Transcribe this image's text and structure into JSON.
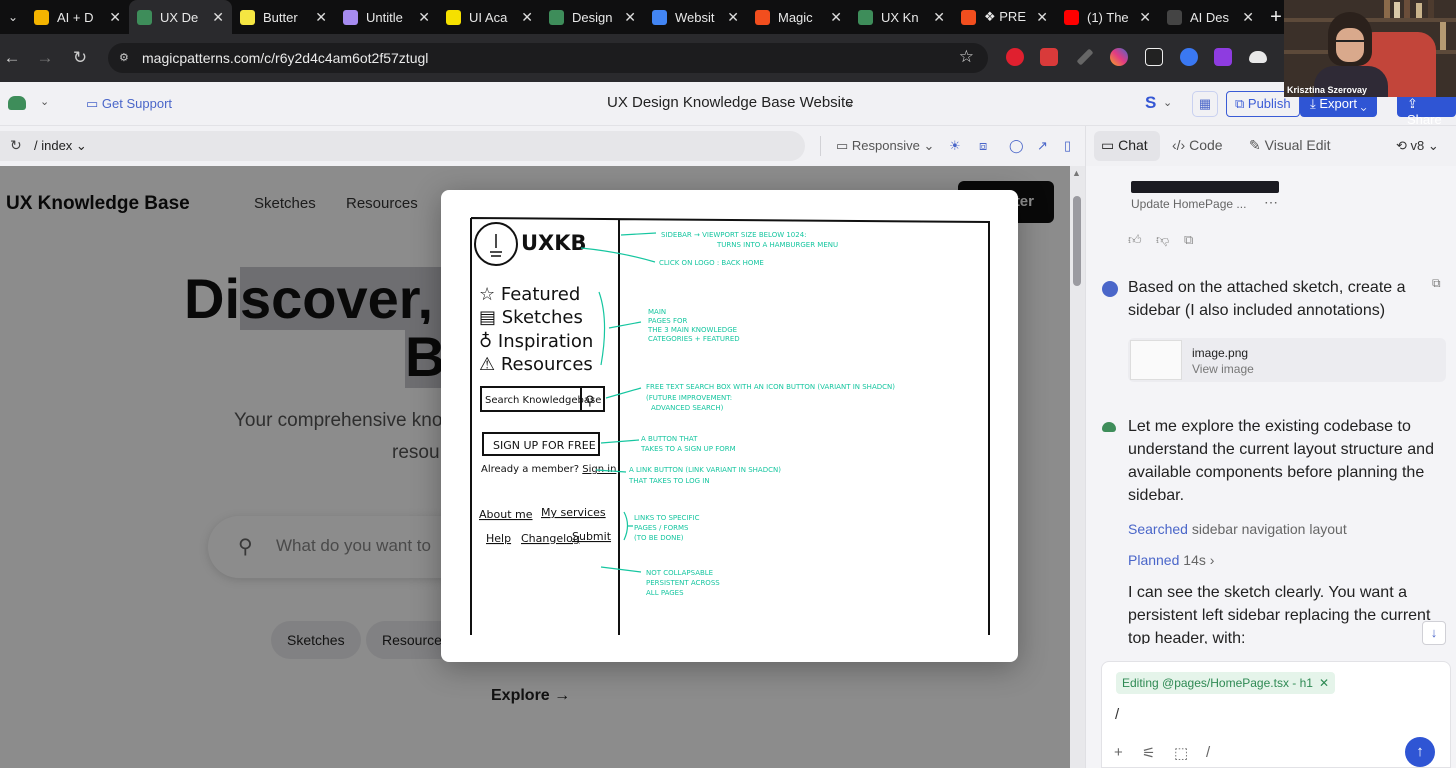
{
  "browser": {
    "tabs": [
      {
        "label": "AI + D",
        "color": "#f4b400",
        "active": false
      },
      {
        "label": "UX De",
        "color": "#3e8d5a",
        "active": true
      },
      {
        "label": "Butter",
        "color": "#f5e642",
        "active": false
      },
      {
        "label": "Untitle",
        "color": "#a68bf0",
        "active": false
      },
      {
        "label": "UI Aca",
        "color": "#f5e000",
        "active": false
      },
      {
        "label": "Design",
        "color": "#3e8d5a",
        "active": false
      },
      {
        "label": "Websit",
        "color": "#4285f4",
        "active": false
      },
      {
        "label": "Magic",
        "color": "#f24e1e",
        "active": false
      },
      {
        "label": "UX Kn",
        "color": "#3e8d5a",
        "active": false
      },
      {
        "label": "❖ PRE",
        "color": "#f24e1e",
        "active": false
      },
      {
        "label": "(1) The",
        "color": "#ff0000",
        "active": false
      },
      {
        "label": "AI Des",
        "color": "#444444",
        "active": false
      }
    ],
    "url": "magicpatterns.com/c/r6y2d4c4am6ot2f57ztugl"
  },
  "app": {
    "support": "Get Support",
    "project_title": "UX Design Knowledge Base Website",
    "avatar_letter": "S",
    "publish": "Publish",
    "export": "Export",
    "share": "Share",
    "path": "/ index",
    "responsive": "Responsive"
  },
  "preview": {
    "logo": "UX Knowledge Base",
    "nav": [
      "Sketches",
      "Resources"
    ],
    "cta_tail": "ter",
    "hero_a": "Di",
    "hero_b": "scover, I",
    "hero_c": "B",
    "sub1": "Your comprehensive kno",
    "sub2": "resou",
    "search_placeholder": "What do you want to",
    "chips": [
      "Sketches",
      "Resources"
    ],
    "explore": "Explore",
    "explore_arrow": "→"
  },
  "sketch": {
    "logo": "UXKB",
    "nav": [
      "Featured",
      "Sketches",
      "Inspiration",
      "Resources"
    ],
    "search": "Search Knowledgebase",
    "signup": "SIGN UP FOR FREE",
    "member": "Already a member?",
    "signin": "Sign in",
    "links_row1": [
      "About me",
      "My services"
    ],
    "links_row2": [
      "Help",
      "Changelog",
      "Submit"
    ],
    "notes": {
      "sidebar1": "SIDEBAR → VIEWPORT SIZE BELOW 1024:",
      "sidebar2": "TURNS INTO A HAMBURGER MENU",
      "logo": "CLICK ON LOGO : BACK HOME",
      "main1": "MAIN",
      "main2": "PAGES FOR",
      "main3": "THE 3 MAIN KNOWLEDGE",
      "main4": "CATEGORIES + FEATURED",
      "search1": "FREE TEXT SEARCH BOX  WITH AN ICON BUTTON (VARIANT IN SHADCN)",
      "search2": "(FUTURE IMPROVEMENT:",
      "search3": "ADVANCED SEARCH)",
      "button1": "A BUTTON THAT",
      "button2": "TAKES TO A SIGN UP FORM",
      "link1": "A LINK BUTTON (LINK VARIANT IN SHADCN)",
      "link2": "THAT TAKES TO LOG IN",
      "links1": "LINKS TO SPECIFIC",
      "links2": "PAGES / FORMS",
      "links3": "(TO BE DONE)",
      "collapse1": "NOT COLLAPSABLE",
      "collapse2": "PERSISTENT ACROSS",
      "collapse3": "ALL PAGES"
    }
  },
  "chat": {
    "tabs": [
      "Chat",
      "Code",
      "Visual Edit"
    ],
    "version": "v8",
    "update_card": "Update HomePage ...",
    "user_msg": "Based on the attached sketch, create a sidebar (I also included annotations)",
    "attachment_name": "image.png",
    "attachment_action": "View image",
    "ai_msg1": "Let me explore the existing codebase to understand the current layout structure and available components before planning the sidebar.",
    "step1_key": "Searched",
    "step1_val": "sidebar navigation layout",
    "step2_key": "Planned",
    "step2_val": "14s ›",
    "ai_msg2": "I can see the sketch clearly. You want a persistent left sidebar replacing the current top header, with:",
    "editing_chip": "Editing @pages/HomePage.tsx - h1",
    "input_value": "/"
  },
  "webcam": {
    "name": "Krisztina Szerovay"
  },
  "colors": {
    "accent": "#2f55d4",
    "annotation": "#16c6a0",
    "brand_green": "#3e8d5a"
  }
}
